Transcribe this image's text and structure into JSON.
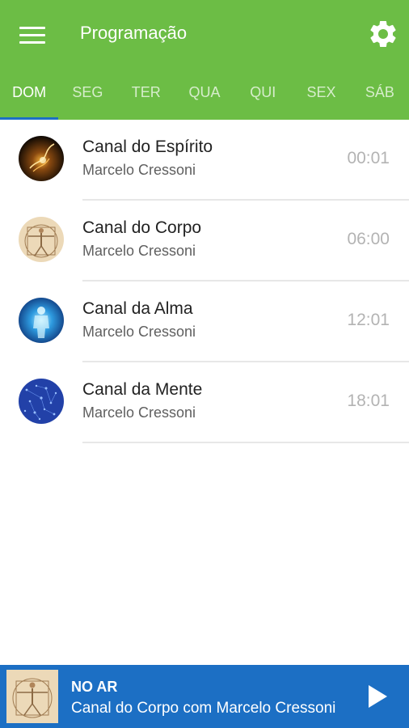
{
  "appbar": {
    "title": "Programação",
    "menu_icon": "hamburger-menu-icon",
    "settings_icon": "gear-icon",
    "color": "#6cbd45"
  },
  "tabs": [
    {
      "label": "DOM",
      "active": true
    },
    {
      "label": "SEG",
      "active": false
    },
    {
      "label": "TER",
      "active": false
    },
    {
      "label": "QUA",
      "active": false
    },
    {
      "label": "QUI",
      "active": false
    },
    {
      "label": "SEX",
      "active": false
    },
    {
      "label": "SÁB",
      "active": false
    }
  ],
  "schedule": [
    {
      "title": "Canal do Espírito",
      "host": "Marcelo Cressoni",
      "time": "00:01",
      "thumbnail": "espirito-light-thumbnail"
    },
    {
      "title": "Canal do Corpo",
      "host": "Marcelo Cressoni",
      "time": "06:00",
      "thumbnail": "vitruvian-man-thumbnail"
    },
    {
      "title": "Canal da Alma",
      "host": "Marcelo Cressoni",
      "time": "12:01",
      "thumbnail": "blue-body-thumbnail"
    },
    {
      "title": "Canal da Mente",
      "host": "Marcelo Cressoni",
      "time": "18:01",
      "thumbnail": "blue-network-thumbnail"
    }
  ],
  "player": {
    "status": "NO AR",
    "now_playing": "Canal do Corpo com Marcelo Cressoni",
    "thumbnail": "vitruvian-man-thumbnail",
    "play_icon": "play-icon",
    "color": "#1c6fc4"
  }
}
